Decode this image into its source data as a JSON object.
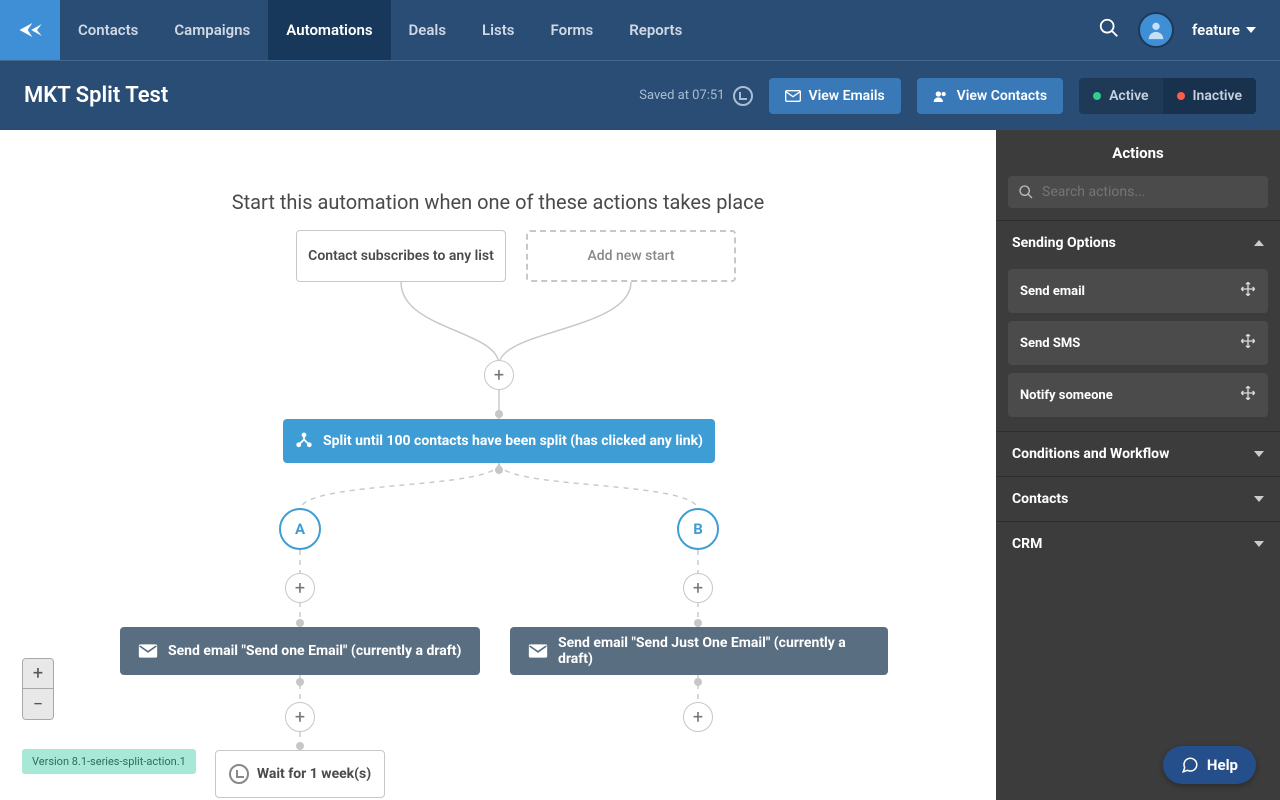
{
  "nav": {
    "items": [
      "Contacts",
      "Campaigns",
      "Automations",
      "Deals",
      "Lists",
      "Forms",
      "Reports"
    ],
    "activeIndex": 2,
    "user_label": "feature"
  },
  "subheader": {
    "title": "MKT Split Test",
    "saved": "Saved at 07:51",
    "view_emails": "View Emails",
    "view_contacts": "View Contacts",
    "active": "Active",
    "inactive": "Inactive"
  },
  "canvas": {
    "instruction": "Start this automation when one of these actions takes place",
    "start1": "Contact subscribes to any list",
    "start2": "Add new start",
    "split": "Split until 100 contacts have been split (has clicked any link)",
    "pathA": "A",
    "pathB": "B",
    "emailA": "Send email \"Send one Email\" (currently a draft)",
    "emailB": "Send email \"Send Just One Email\" (currently a draft)",
    "wait": "Wait for 1 week(s)",
    "version": "Version 8.1-series-split-action.1"
  },
  "sidebar": {
    "title": "Actions",
    "search_placeholder": "Search actions...",
    "sections": {
      "sending": {
        "label": "Sending Options",
        "expanded": true,
        "items": [
          "Send email",
          "Send SMS",
          "Notify someone"
        ]
      },
      "conditions": {
        "label": "Conditions and Workflow",
        "expanded": false
      },
      "contacts": {
        "label": "Contacts",
        "expanded": false
      },
      "crm": {
        "label": "CRM",
        "expanded": false
      }
    }
  },
  "help": "Help"
}
